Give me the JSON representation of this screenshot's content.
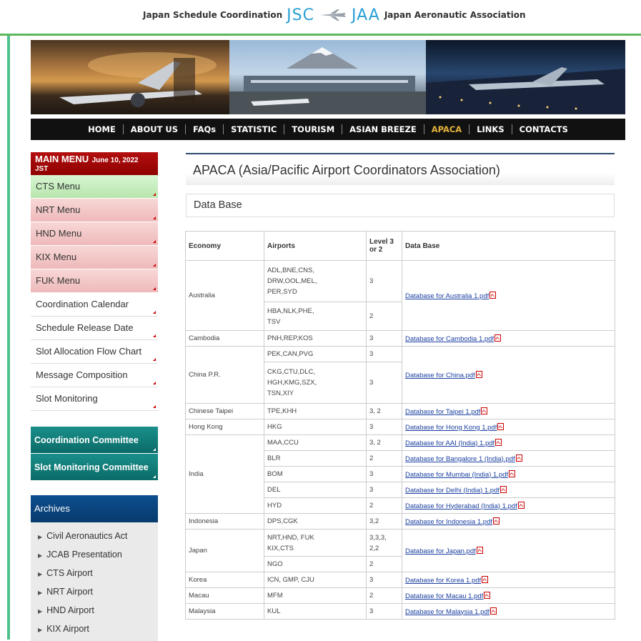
{
  "header": {
    "left_text": "Japan Schedule Coordination",
    "jsc": "JSC",
    "jaa": "JAA",
    "right_text": "Japan Aeronautic Association"
  },
  "nav": {
    "items": [
      "HOME",
      "ABOUT US",
      "FAQs",
      "STATISTIC",
      "TOURISM",
      "ASIAN BREEZE",
      "APACA",
      "LINKS",
      "CONTACTS"
    ],
    "active": "APACA"
  },
  "sidebar": {
    "main_menu_title": "MAIN MENU",
    "date_part1": "June 10, 2022",
    "date_part2": "JST",
    "menu_items": [
      "CTS Menu",
      "NRT Menu",
      "HND Menu",
      "KIX Menu",
      "FUK Menu",
      "Coordination Calendar",
      "Schedule Release Date",
      "Slot Allocation Flow Chart",
      "Message Composition",
      "Slot Monitoring"
    ],
    "committees": [
      "Coordination Committee",
      "Slot Monitoring Committee"
    ],
    "archives_title": "Archives",
    "archives": [
      "Civil Aeronautics Act",
      "JCAB Presentation",
      "CTS Airport",
      "NRT Airport",
      "HND Airport",
      "KIX Airport"
    ]
  },
  "main": {
    "title": "APACA (Asia/Pacific Airport Coordinators Association)",
    "subtitle": "Data Base"
  },
  "table": {
    "headers": [
      "Economy",
      "Airports",
      "Level 3 or 2",
      "Data Base"
    ],
    "rows": [
      {
        "economy": "Australia",
        "airports": "ADL,BNE,CNS,\nDRW,OOL,MEL,\nPER,SYD",
        "level": "3",
        "db": "Database for Australia 1.pdf"
      },
      {
        "airports": "HBA,NLK,PHE,\nTSV",
        "level": "2"
      },
      {
        "economy": "Cambodia",
        "airports": "PNH,REP,KOS",
        "level": "3",
        "db": "Database for Cambodia 1.pdf"
      },
      {
        "economy": "China P.R.",
        "airports": "PEK,CAN,PVG",
        "level": "3",
        "db": "Database for China.pdf"
      },
      {
        "airports": "CKG,CTU,DLC,\nHGH,KMG,SZX,\nTSN,XIY",
        "level": "3"
      },
      {
        "economy": "Chinese Taipei",
        "airports": "TPE,KHH",
        "level": "3, 2",
        "db": "Database for Taipei 1.pdf"
      },
      {
        "economy": "Hong Kong",
        "airports": "HKG",
        "level": "3",
        "db": "Database for Hong Kong 1.pdf"
      },
      {
        "economy": "India",
        "airports": "MAA,CCU",
        "level": "3, 2",
        "db": "Database for AAI (India) 1.pdf"
      },
      {
        "airports": "BLR",
        "level": "2",
        "db": "Database for Bangalore 1 (India).pdf"
      },
      {
        "airports": "BOM",
        "level": "3",
        "db": "Database for Mumbai (India) 1.pdf"
      },
      {
        "airports": "DEL",
        "level": "3",
        "db": "Database for Delhi (India) 1.pdf"
      },
      {
        "airports": "HYD",
        "level": "2",
        "db": "Database for Hyderabad (India) 1.pdf"
      },
      {
        "economy": "Indonesia",
        "airports": "DPS,CGK",
        "level": "3,2",
        "db": "Database for Indonesia 1.pdf"
      },
      {
        "economy": "Japan",
        "airports": "NRT,HND, FUK\nKIX,CTS",
        "level": "3,3,3,\n2,2",
        "db": "Database for Japan.pdf"
      },
      {
        "airports": "NGO",
        "level": "2"
      },
      {
        "economy": "Korea",
        "airports": "ICN, GMP, CJU",
        "level": "3",
        "db": "Database for Korea 1.pdf"
      },
      {
        "economy": "Macau",
        "airports": "MFM",
        "level": "2",
        "db": "Database for Macau 1.pdf"
      },
      {
        "economy": "Malaysia",
        "airports": "KUL",
        "level": "3",
        "db": "Database for Malaysia 1.pdf"
      }
    ]
  },
  "colors": {
    "nav_bg": "#111111",
    "nav_active": "#e3b23c",
    "main_menu_red": "#a00000",
    "committee_teal": "#0e7a76",
    "archives_blue": "#0a4580",
    "link": "#1a3fa0",
    "accent_green": "#5cb85c"
  }
}
